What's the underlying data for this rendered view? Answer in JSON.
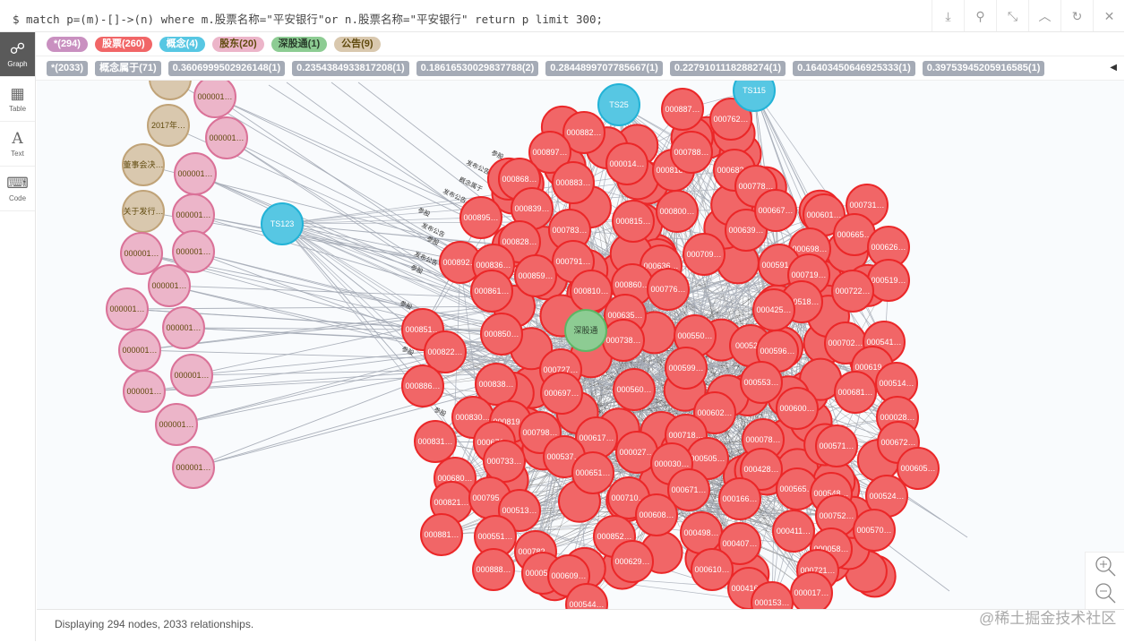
{
  "query": "$ match p=(m)-[]->(n) where m.股票名称=\"平安银行\"or n.股票名称=\"平安银行\" return p limit 300;",
  "toolbar": {
    "icons": [
      "download-icon",
      "pin-icon",
      "collapse-icon",
      "chevron-up-icon",
      "refresh-icon",
      "close-icon"
    ]
  },
  "sidebar": [
    {
      "label": "Graph",
      "icon": "graph-icon",
      "active": true
    },
    {
      "label": "Table",
      "icon": "table-icon"
    },
    {
      "label": "Text",
      "icon": "text-icon"
    },
    {
      "label": "Code",
      "icon": "code-icon"
    }
  ],
  "node_labels": [
    {
      "text": "*(294)",
      "bg": "#c990c0",
      "fg": "#fff"
    },
    {
      "text": "股票(260)",
      "bg": "#f16667",
      "fg": "#fff"
    },
    {
      "text": "概念(4)",
      "bg": "#57c7e3",
      "fg": "#fff"
    },
    {
      "text": "股东(20)",
      "bg": "#ecb5c9",
      "fg": "#604a0e"
    },
    {
      "text": "深股通(1)",
      "bg": "#8dcc93",
      "fg": "#2a3e2c"
    },
    {
      "text": "公告(9)",
      "bg": "#d9c8ae",
      "fg": "#604a0e"
    }
  ],
  "relationship_types": [
    "*(2033)",
    "概念属于(71)",
    "0.3606999502926148(1)",
    "0.2354384933817208(1)",
    "0.18616530029837788(2)",
    "0.2844899707785667(1)",
    "0.2279101118288274(1)",
    "0.16403450646925333(1)",
    "0.39753945205916585(1)"
  ],
  "colors": {
    "stock": "#f16667",
    "stock_border": "#eb2728",
    "concept": "#57c7e3",
    "concept_border": "#23b3d7",
    "holder": "#ecb5c9",
    "holder_border": "#da7298",
    "sgt": "#8dcc93",
    "sgt_border": "#5db665",
    "notice": "#d9c8ae",
    "notice_border": "#c0a378",
    "edge": "#a5abb6"
  },
  "graph": {
    "stocks": [
      "000887…",
      "000762…",
      "000882…",
      "000897…",
      "000014…",
      "000818…",
      "000788…",
      "000682…",
      "000868…",
      "000883…",
      "000778…",
      "000895…",
      "000839…",
      "000815…",
      "000800…",
      "000639…",
      "000667…",
      "000601…",
      "000731…",
      "000828…",
      "000783…",
      "000709…",
      "000698…",
      "000665…",
      "000626…",
      "000892…",
      "000836…",
      "000791…",
      "000636…",
      "000591…",
      "000719…",
      "000519…",
      "000859…",
      "000810…",
      "000860…",
      "000776…",
      "000722…",
      "000861…",
      "000518…",
      "000635…",
      "000425…",
      "000851…",
      "000850…",
      "000738…",
      "000550…",
      "00052…",
      "000596…",
      "000702…",
      "000541…",
      "000822…",
      "000727…",
      "000599…",
      "000619…",
      "000886…",
      "000838…",
      "000697…",
      "000560…",
      "000553…",
      "000681…",
      "000514…",
      "000600…",
      "000602…",
      "000830…",
      "000819…",
      "000028…",
      "000617…",
      "000718…",
      "000078…",
      "000798…",
      "000831…",
      "000670…",
      "000571…",
      "000672…",
      "000027…",
      "000537…",
      "000505…",
      "000733…",
      "000030…",
      "000428…",
      "000605…",
      "000651…",
      "000680…",
      "000565…",
      "000671…",
      "000548…",
      "000524…",
      "000821…",
      "000795…",
      "000710…",
      "000166…",
      "000513…",
      "000752…",
      "000608…",
      "000570…",
      "000498…",
      "000881…",
      "000551…",
      "000852…",
      "000411…",
      "000407…",
      "000782…",
      "000058…",
      "000888…",
      "000052…",
      "000609…",
      "000629…",
      "000610…",
      "000721…",
      "000416…",
      "000017…",
      "000544…",
      "000153…"
    ],
    "concepts": [
      "TS25",
      "TS115",
      "TS123"
    ],
    "sgt": [
      "深股通"
    ],
    "holders": [
      "000001…",
      "000001…",
      "000001…",
      "000001…",
      "000001…",
      "000001…",
      "000001…",
      "000001…",
      "000001…",
      "000001…",
      "000001…",
      "000001…",
      "000001…",
      "000001…"
    ],
    "notices": [
      "",
      "2017年…",
      "董事会决…",
      "关于发行…"
    ],
    "edge_labels": [
      "参股",
      "发布公告",
      "概念属于",
      "发布公告",
      "参股",
      "发布公告",
      "参股",
      "发布公告",
      "参股",
      "参股",
      "参股",
      "参股"
    ]
  },
  "footer": "Displaying 294 nodes, 2033 relationships.",
  "zoom": {
    "in": "zoom-in-icon",
    "out": "zoom-out-icon"
  },
  "watermark": "@稀土掘金技术社区"
}
